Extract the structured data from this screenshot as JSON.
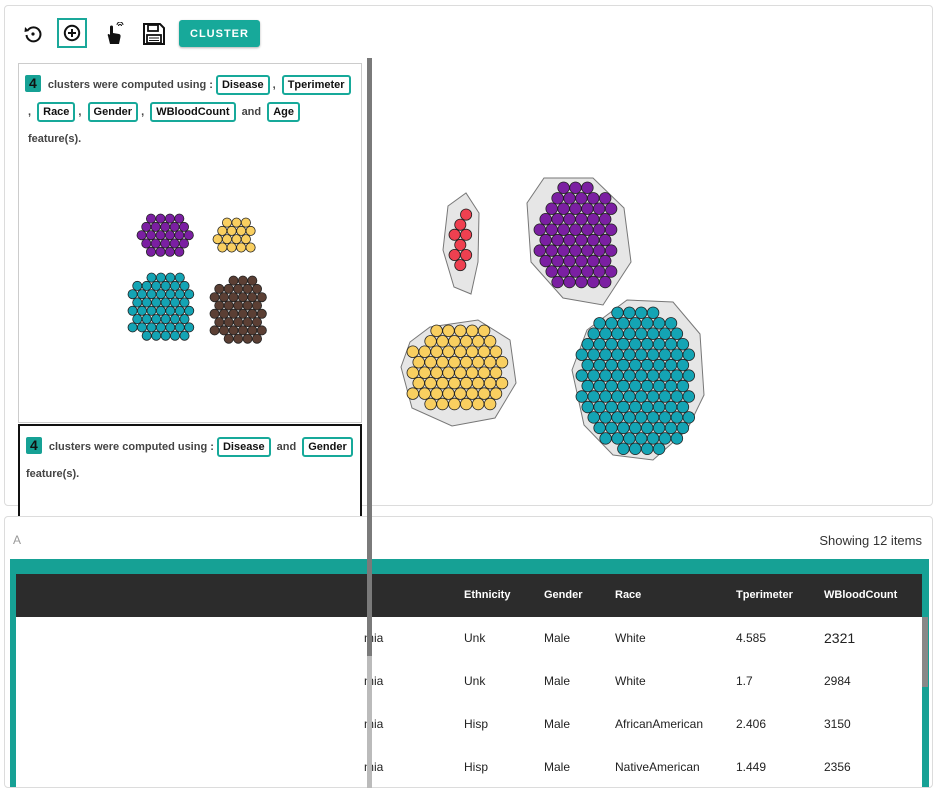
{
  "toolbar": {
    "reset_icon": "undo-icon",
    "add_icon": "plus-circle-icon",
    "pointer_icon": "hand-pointer-icon",
    "save_icon": "floppy-disk-icon",
    "cluster_label": "CLUSTER"
  },
  "history": [
    {
      "count": "4",
      "prefix": "clusters were computed using :",
      "features": [
        "Disease",
        "Tperimeter",
        "Race",
        "Gender",
        "WBloodCount",
        "Age"
      ],
      "and": "and",
      "suffix": "feature(s)."
    },
    {
      "count": "4",
      "prefix": "clusters were computed using :",
      "features": [
        "Disease",
        "Gender"
      ],
      "and": "and",
      "suffix": "feature(s)."
    }
  ],
  "colors": {
    "accent": "#17a99a",
    "purple": "#7b1fa2",
    "yellow": "#f9cf60",
    "teal": "#14a4b4",
    "brown": "#5b3f34",
    "red": "#ef4050"
  },
  "table": {
    "left_label": "A",
    "showing": "Showing 12 items",
    "columns": [
      "Ethnicity",
      "Gender",
      "Race",
      "Tperimeter",
      "WBloodCount"
    ],
    "rows": [
      {
        "disease": "mia",
        "ethnicity": "Unk",
        "gender": "Male",
        "race": "White",
        "tperimeter": "4.585",
        "wbc": "2321"
      },
      {
        "disease": "mia",
        "ethnicity": "Unk",
        "gender": "Male",
        "race": "White",
        "tperimeter": "1.7",
        "wbc": "2984"
      },
      {
        "disease": "mia",
        "ethnicity": "Hisp",
        "gender": "Male",
        "race": "AfricanAmerican",
        "tperimeter": "2.406",
        "wbc": "3150"
      },
      {
        "disease": "mia",
        "ethnicity": "Hisp",
        "gender": "Male",
        "race": "NativeAmerican",
        "tperimeter": "1.449",
        "wbc": "2356"
      }
    ]
  }
}
